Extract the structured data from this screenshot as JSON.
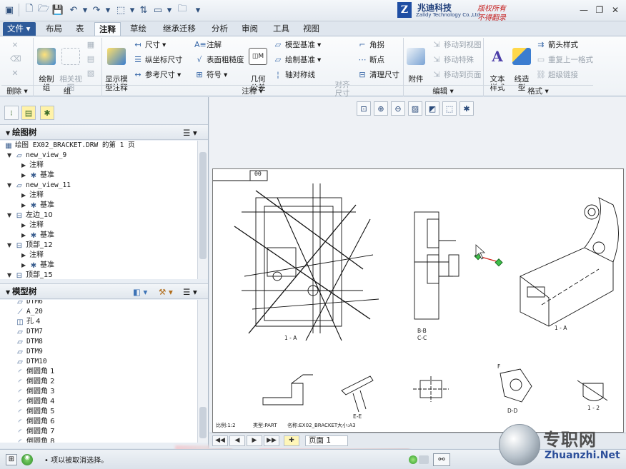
{
  "titlebar": {
    "logo_mark": "Z",
    "logo_cn": "兆迪科技",
    "logo_en": "Zalldy Technology Co.,Ltd",
    "logo_right1": "版权所有",
    "logo_right2": "不得翻录"
  },
  "menu": {
    "file": "文件",
    "tabs": [
      "布局",
      "表",
      "注释",
      "草绘",
      "继承迁移",
      "分析",
      "审阅",
      "工具",
      "视图"
    ],
    "active_tab": "注释"
  },
  "ribbon": {
    "delete_group": "删除",
    "group_group": "组",
    "annot_group": "注释",
    "edit_group": "编辑",
    "format_group": "格式",
    "draw_group_btn": "绘制\n组",
    "rel_view_btn": "相关视\n图",
    "show_model_btn": "显示模\n型注释",
    "dim_btn": "尺寸",
    "ord_dim_btn": "纵坐标尺寸",
    "ref_dim_btn": "参考尺寸",
    "note_btn": "注解",
    "surface_btn": "表面粗糙度",
    "symbol_btn": "符号",
    "geo_tol_btn": "几何\n公差",
    "model_datum_btn": "模型基准",
    "draw_datum_btn": "绘制基准",
    "axis_sym_btn": "轴对称线",
    "align_dim_btn": "对齐\n尺寸",
    "corner_btn": "角拐",
    "break_btn": "断点",
    "clean_dim_btn": "清理尺寸",
    "attach_btn": "附件",
    "move_view_btn": "移动到视图",
    "move_special_btn": "移动特殊",
    "move_page_btn": "移动到页面",
    "text_style_btn": "文本\n样式",
    "line_style_btn": "线造\n型",
    "arrow_style_btn": "箭头样式",
    "repeat_format_btn": "重复上一格式",
    "hyperlink_btn": "超级链接"
  },
  "draw_tree": {
    "title": "绘图树",
    "root": "绘图 EX02_BRACKET.DRW 的第 1 页",
    "items": [
      {
        "name": "new_view_9",
        "children": [
          "注释",
          "基准"
        ]
      },
      {
        "name": "new_view_11",
        "children": [
          "注释",
          "基准"
        ]
      },
      {
        "name": "左边_10",
        "children": [
          "注释",
          "基准"
        ]
      },
      {
        "name": "顶部_12",
        "children": [
          "注释",
          "基准"
        ]
      },
      {
        "name": "顶部_15",
        "children": []
      }
    ]
  },
  "model_tree": {
    "title": "模型树",
    "items": [
      "DTM6",
      "A_20",
      "孔 4",
      "DTM7",
      "DTM8",
      "DTM9",
      "DTM10",
      "倒圆角 1",
      "倒圆角 2",
      "倒圆角 3",
      "倒圆角 4",
      "倒圆角 5",
      "倒圆角 6",
      "倒圆角 7",
      "倒圆角 8"
    ]
  },
  "sheet": {
    "corner_tag": "θθ",
    "labels": {
      "view_bb": "B-B",
      "view_cc": "C-C",
      "view_a": "1 - A",
      "view_a2": "1 - A",
      "view_f": "F",
      "view_f2": "1 - 2",
      "view_ee": "E-E",
      "view_dd": "D-D"
    },
    "info_left": "比例:1:2",
    "info_type": "类型:PART",
    "info_name": "名称:EX02_BRACKET",
    "info_size": "大小:A3"
  },
  "pagenav": {
    "page_label": "页面 1"
  },
  "status": {
    "message": "• 项以被取消选择。"
  },
  "watermark": {
    "cn": "专职网",
    "en": "Zhuanzhi.Net"
  }
}
